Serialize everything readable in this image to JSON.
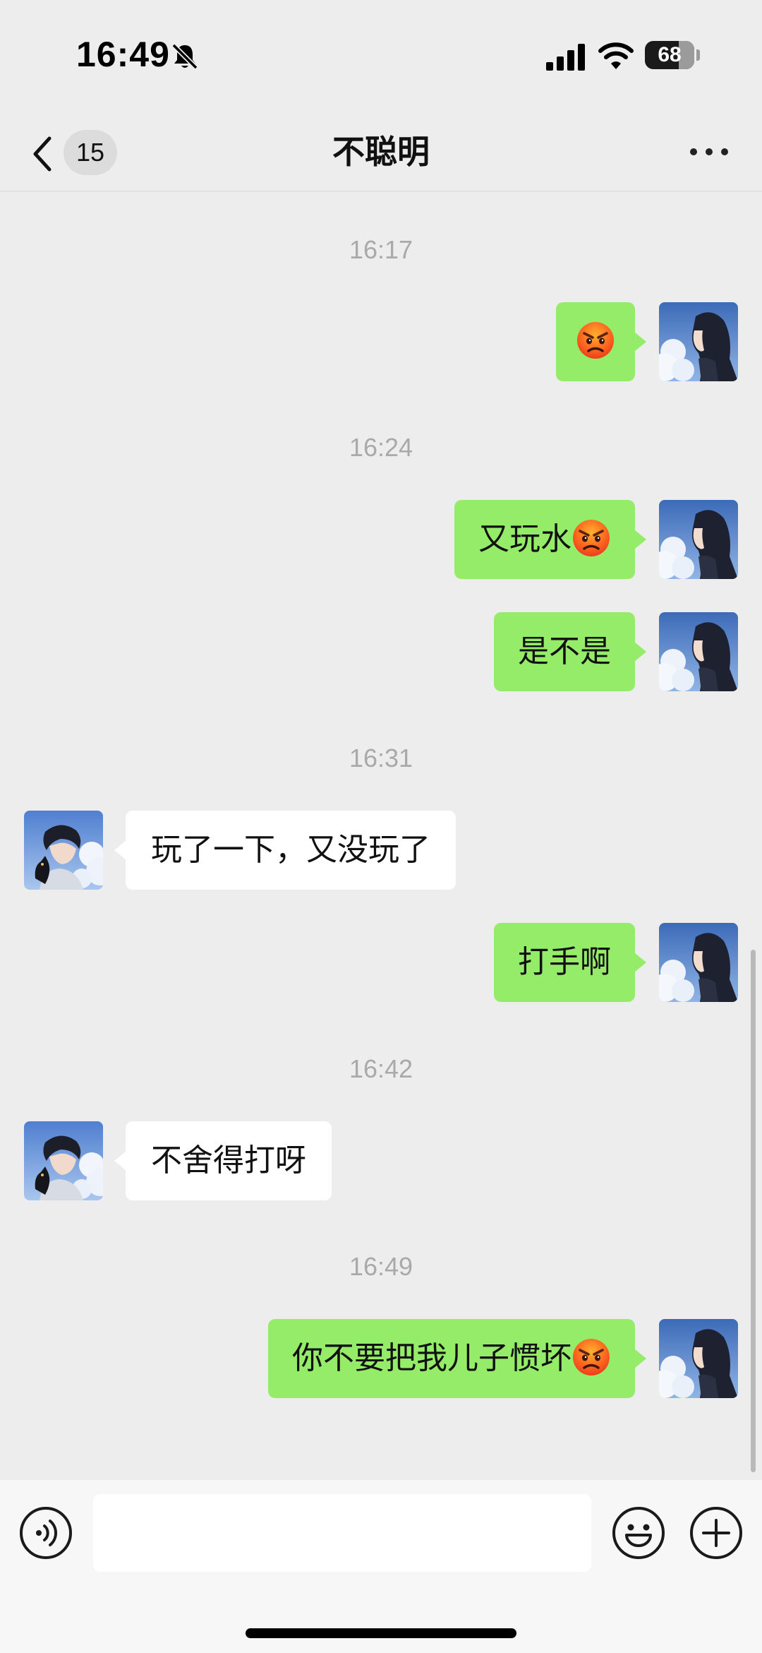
{
  "status_bar": {
    "time": "16:49",
    "battery": "68",
    "icons": [
      "bell-slash-icon",
      "cellular-signal-icon",
      "wifi-icon",
      "battery-icon"
    ]
  },
  "nav": {
    "title": "不聪明",
    "unread_count": "15",
    "icons": [
      "chevron-left-icon",
      "more-icon"
    ]
  },
  "messages": {
    "ts1": "16:17",
    "m1": "",
    "ts2": "16:24",
    "m2": "又玩水",
    "m3": "是不是",
    "ts3": "16:31",
    "m4": "玩了一下，又没玩了",
    "m5": "打手啊",
    "ts4": "16:42",
    "m6": "不舍得打呀",
    "ts5": "16:49",
    "m7": "你不要把我儿子惯坏"
  },
  "message_senders": [
    "me",
    "me",
    "me",
    "peer",
    "me",
    "peer",
    "me"
  ],
  "emoji": "angry-face-icon",
  "input": {
    "value": "",
    "icons": [
      "voice-icon",
      "emoji-icon",
      "plus-icon"
    ]
  },
  "colors": {
    "background": "#ededed",
    "outgoing_bubble": "#95ec69",
    "incoming_bubble": "#ffffff",
    "timestamp": "#a9a9a9",
    "input_bar": "#f7f7f7"
  }
}
